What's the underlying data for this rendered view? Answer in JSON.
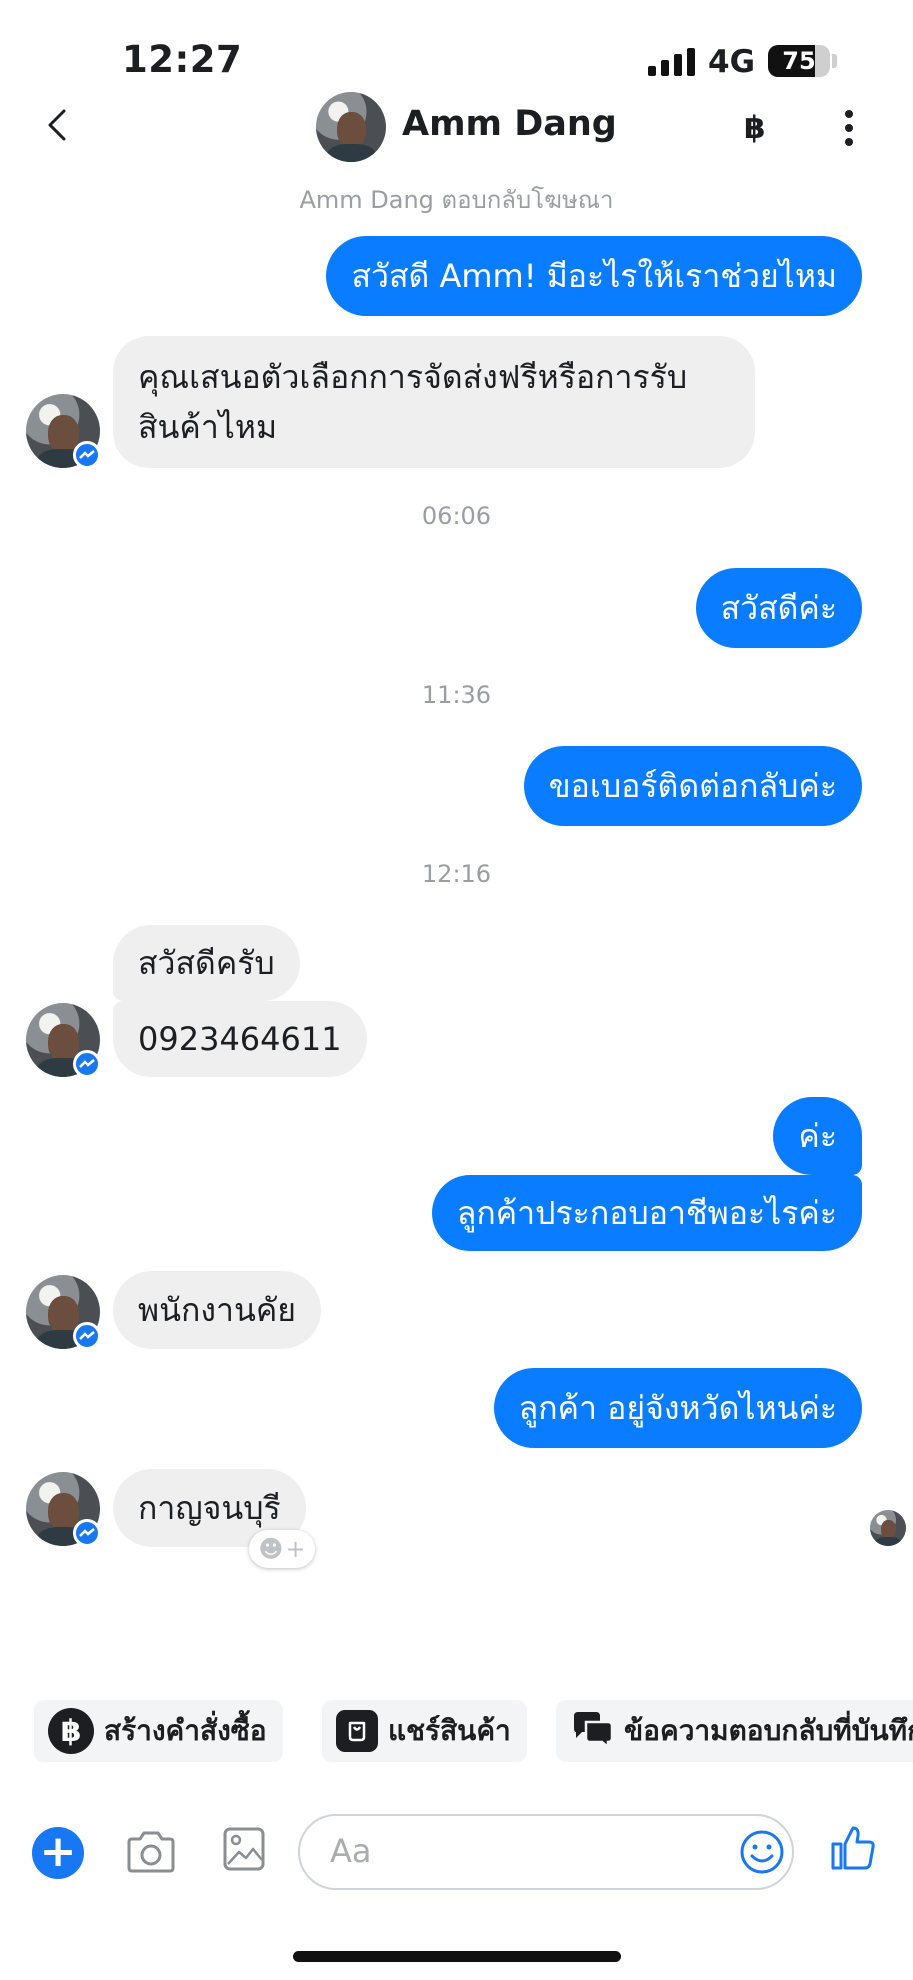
{
  "status_bar": {
    "time": "12:27",
    "network": "4G",
    "battery": "75",
    "battery_level": 0.75
  },
  "header": {
    "contact_name": "Amm Dang",
    "currency_symbol": "฿",
    "subtitle": "Amm Dang ตอบกลับโฆษณา"
  },
  "messages": [
    {
      "from": "me",
      "text": "สวัสดี Amm! มีอะไรให้เราช่วยไหม"
    },
    {
      "from": "contact",
      "lines": [
        "คุณเสนอตัวเลือกการจัดส่งฟรีหรือการรับ",
        "สินค้าไหม"
      ]
    },
    {
      "timestamp": "06:06"
    },
    {
      "from": "me",
      "text": "สวัสดีค่ะ"
    },
    {
      "timestamp": "11:36"
    },
    {
      "from": "me",
      "text": "ขอเบอร์ติดต่อกลับค่ะ"
    },
    {
      "timestamp": "12:16"
    },
    {
      "from": "contact",
      "text": "สวัสดีครับ"
    },
    {
      "from": "contact",
      "text": "0923464611"
    },
    {
      "from": "me",
      "text": "ค่ะ"
    },
    {
      "from": "me",
      "text": "ลูกค้าประกอบอาชีพอะไรค่ะ"
    },
    {
      "from": "contact",
      "text": "พนักงานคัย"
    },
    {
      "from": "me",
      "text": "ลูกค้า อยู่จังหวัดไหนค่ะ"
    },
    {
      "from": "contact",
      "text": "กาญจนบุรี"
    }
  ],
  "quick_actions": [
    {
      "label": "สร้างคำสั่งซื้อ",
      "icon": "baht-circle-icon"
    },
    {
      "label": "แชร์สินค้า",
      "icon": "bag-icon"
    },
    {
      "label": "ข้อความตอบกลับที่บันทึก",
      "icon": "saved-replies-icon"
    }
  ],
  "composer": {
    "placeholder": "Aa"
  },
  "colors": {
    "accent": "#0a7cff",
    "incoming_bubble": "#efefef",
    "timestamp": "#9a9ea3"
  }
}
